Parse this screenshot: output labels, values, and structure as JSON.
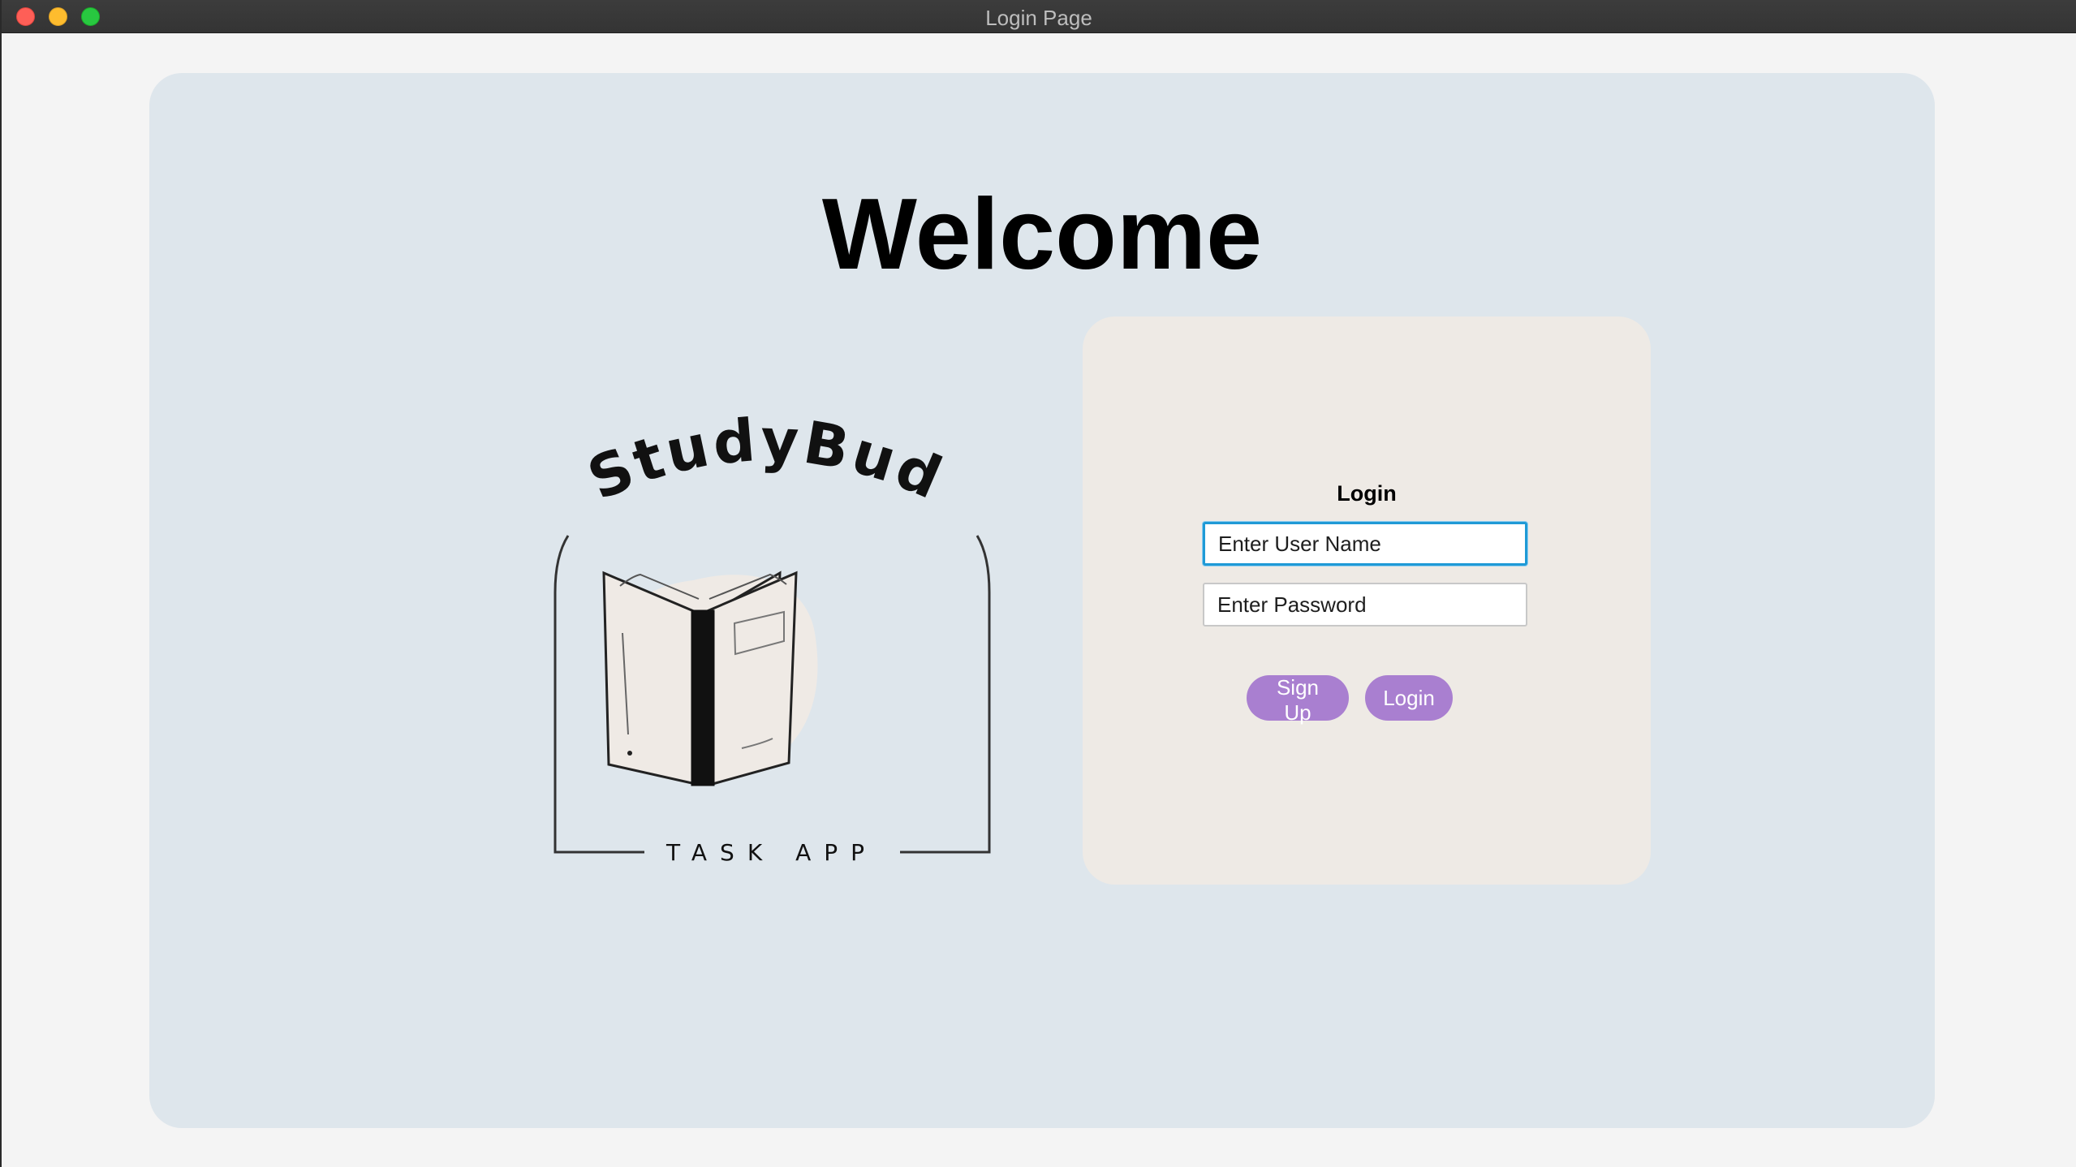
{
  "window": {
    "title": "Login Page"
  },
  "main": {
    "heading": "Welcome"
  },
  "logo": {
    "brand": "StudyBud",
    "tagline": "TASK APP"
  },
  "login": {
    "title": "Login",
    "username_placeholder": "Enter User Name",
    "password_placeholder": "Enter Password",
    "signup_label": "Sign Up",
    "login_label": "Login"
  },
  "colors": {
    "content_bg": "#dee6ec",
    "card_bg": "#eeeae5",
    "button_accent": "#a97fd0",
    "focus_ring": "#1f9ad6"
  }
}
